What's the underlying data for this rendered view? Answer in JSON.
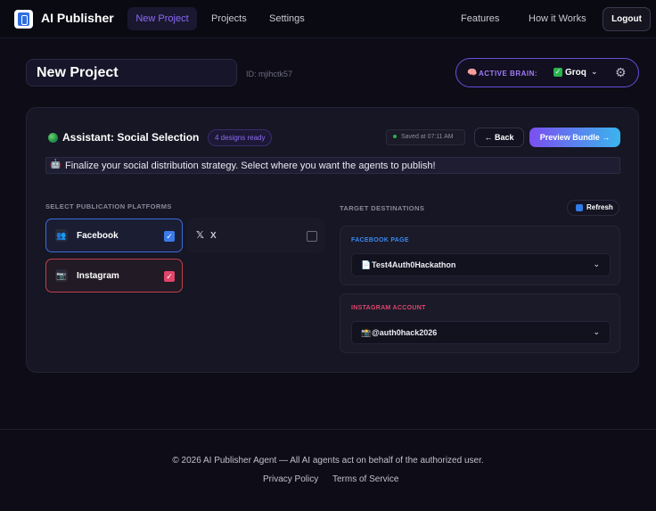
{
  "nav": {
    "brand": "AI Publisher",
    "links": [
      "New Project",
      "Projects",
      "Settings"
    ],
    "right_links": [
      "Features",
      "How it Works"
    ],
    "logout": "Logout"
  },
  "project": {
    "name": "New Project",
    "id": "ID: mjihctk57",
    "brain_label": "ACTIVE BRAIN:",
    "brain_value": "Groq"
  },
  "assistant": {
    "title": "Assistant: Social Selection",
    "badge": "4 designs ready",
    "saved": "Saved at 07:11 AM",
    "back": "← Back",
    "preview": "Preview Bundle →",
    "notice": "Finalize your social distribution strategy. Select where you want the agents to publish!"
  },
  "platforms": {
    "label": "SELECT PUBLICATION PLATFORMS",
    "items": [
      {
        "name": "Facebook",
        "checked": true
      },
      {
        "name": "X",
        "checked": false
      },
      {
        "name": "Instagram",
        "checked": true
      }
    ]
  },
  "destinations": {
    "label": "TARGET DESTINATIONS",
    "refresh": "Refresh",
    "facebook_label": "FACEBOOK PAGE",
    "facebook_value": "Test4Auth0Hackathon",
    "instagram_label": "INSTAGRAM ACCOUNT",
    "instagram_value": "@auth0hack2026"
  },
  "footer": {
    "copyright": "© 2026 AI Publisher Agent — All AI agents act on behalf of the authorized user.",
    "links": [
      "Privacy Policy",
      "Terms of Service"
    ]
  },
  "colors": {
    "accent": "#8b6cf6",
    "facebook": "#3b88f0",
    "instagram": "#e0456a",
    "success": "#2bb24c"
  }
}
